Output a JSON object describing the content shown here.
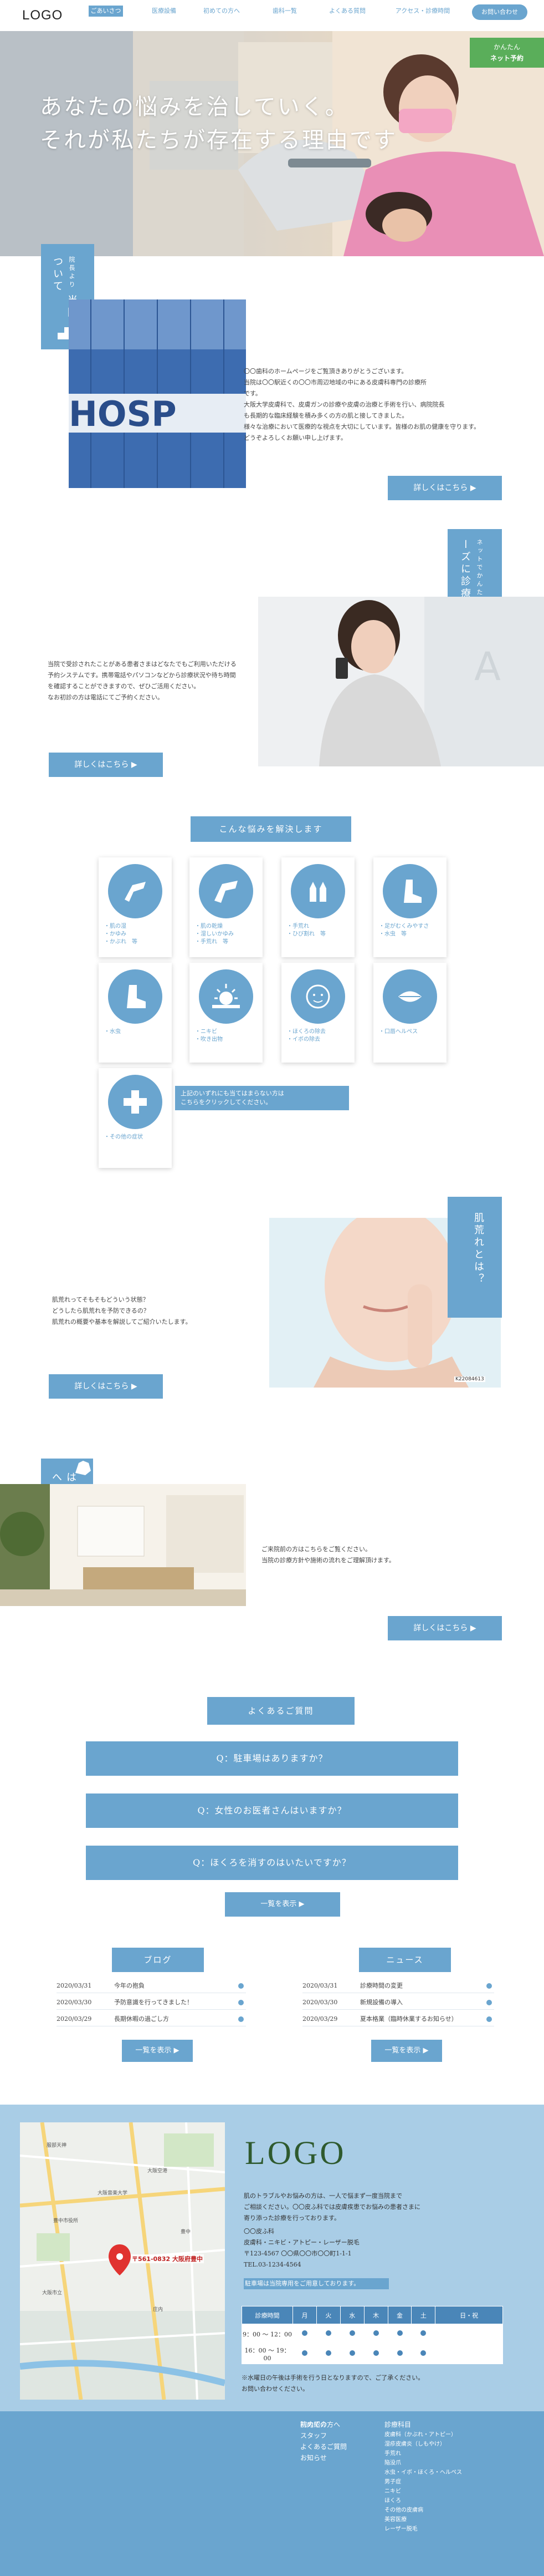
{
  "header": {
    "logo": "LOGO",
    "nav": [
      "ごあいさつ",
      "医療設備",
      "初めての方へ",
      "歯科一覧",
      "よくある質問",
      "アクセス・診療時間"
    ],
    "contact_button": "お問い合わせ",
    "side_button_line1": "かんたん",
    "side_button_line2": "ネット予約"
  },
  "hero": {
    "line1": "あなたの悩みを治していく。",
    "line2": "それが私たちが存在する理由です"
  },
  "greeting": {
    "label_small": "院長より",
    "label": "当院について",
    "text": [
      "〇〇歯科のホームページをご覧頂きありがとうございます。",
      "当院は〇〇駅近くの〇〇市周辺地域の中にある皮膚科専門の診療所",
      "です。",
      "大阪大学皮膚科で、皮膚ガンの診療や皮膚の治療と手術を行い、病院院長",
      "も長期的な臨床経験を積み多くの方の肌と接してきました。",
      "様々な治療において医療的な視点を大切にしています。皆様のお肌の健康を守ります。",
      "どうぞよろしくお願い申し上げます。"
    ],
    "more": "詳しくはこちら ▶"
  },
  "reserve": {
    "label_small": "ネットでかんたん",
    "label": "スムーズに診療",
    "text": [
      "当院で受診されたことがある患者さまはどなたでもご利用いただける",
      "予約システムです。携帯電話やパソコンなどから診療状況や待ち時間",
      "を確認することができますので、ぜひご活用ください。",
      "なお初診の方は電話にてご予約ください。"
    ],
    "more": "詳しくはこちら ▶"
  },
  "worries": {
    "title": "こんな悩みを解決します",
    "cards": [
      {
        "icon": "arm-icon",
        "lines": [
          "・肌の湿",
          "・かゆみ",
          "・かぶれ　等"
        ]
      },
      {
        "icon": "arm2-icon",
        "lines": [
          "・肌の乾燥",
          "・湿しいかゆみ",
          "・手荒れ　等"
        ]
      },
      {
        "icon": "hands-icon",
        "lines": [
          "・手荒れ",
          "・ひび割れ　等"
        ]
      },
      {
        "icon": "foot-icon",
        "lines": [
          "・足がむくみやすさ",
          "・水虫　等"
        ]
      },
      {
        "icon": "leg-icon",
        "lines": [
          "・水虫"
        ]
      },
      {
        "icon": "sun-icon",
        "lines": [
          "・ニキビ",
          "・吹き出物"
        ]
      },
      {
        "icon": "face-icon",
        "lines": [
          "・ほくろの除去",
          "・イボの除去"
        ]
      },
      {
        "icon": "lips-icon",
        "lines": [
          "・口唇ヘルペス"
        ]
      },
      {
        "icon": "cross-icon",
        "lines": [
          "・その他の症状"
        ]
      }
    ],
    "note_line1": "上記のいずれにも当てはまらない方は",
    "note_line2": "こちらをクリックしてください。"
  },
  "beauty": {
    "label": "肌荒れとは？",
    "text": [
      "肌荒れってそもそもどういう状態？",
      "どうしたら肌荒れを予防できるの？",
      "肌荒れの概要や基本を解説してご紹介いたします。"
    ],
    "more": "詳しくはこちら ▶",
    "photo_id": "K22084613"
  },
  "first": {
    "label": "はじめての方へ",
    "text": [
      "ご来院前の方はこちらをご覧ください。",
      "当院の診療方針や施術の流れをご理解頂けます。"
    ],
    "more": "詳しくはこちら ▶"
  },
  "faq": {
    "title": "よくあるご質問",
    "items": [
      "Q：駐車場はありますか？",
      "Q：女性のお医者さんはいますか？",
      "Q：ほくろを消すのはいたいですか？"
    ],
    "more": "一覧を表示 ▶"
  },
  "blog": {
    "title": "ブログ",
    "rows": [
      {
        "date": "2020/03/31",
        "title": "今年の抱負"
      },
      {
        "date": "2020/03/30",
        "title": "予防意識を行ってきました！"
      },
      {
        "date": "2020/03/29",
        "title": "長期休暇の過ごし方"
      }
    ],
    "more": "一覧を表示 ▶"
  },
  "news": {
    "title": "ニュース",
    "rows": [
      {
        "date": "2020/03/31",
        "title": "診療時間の変更"
      },
      {
        "date": "2020/03/30",
        "title": "新規設備の導入"
      },
      {
        "date": "2020/03/29",
        "title": "夏本格業（臨時休業するお知らせ）"
      }
    ],
    "more": "一覧を表示 ▶"
  },
  "access": {
    "logo": "LOGO",
    "intro": [
      "肌のトラブルやお悩みの方は、一人で悩まず一度当院まで",
      "ご相談ください。〇〇皮ふ科では皮膚疾患でお悩みの患者さまに",
      "寄り添った診療を行っております。"
    ],
    "clinic": "〇〇皮ふ科",
    "departments": "皮膚科・ニキビ・アトピー・レーザー脱毛",
    "postal": "〒123-4567 〇〇県〇〇市〇〇町1-1-1",
    "tel": "TEL.03-1234-4564",
    "highlight": "駐車場は当院専用をご用意しております。",
    "map_label": "〒561-0832 大阪府豊中",
    "map_places": [
      "服部天神",
      "大阪音楽大学",
      "豊中市役所",
      "大阪市立",
      "大阪空港",
      "豊中",
      "庄内"
    ],
    "schedule": {
      "header": [
        "診療時間",
        "月",
        "火",
        "水",
        "木",
        "金",
        "土",
        "日・祝"
      ],
      "rows": [
        {
          "time": "9：00 ～ 12：00",
          "days": [
            true,
            true,
            true,
            true,
            true,
            true,
            false
          ]
        },
        {
          "time": "16：00 ～ 19：00",
          "days": [
            true,
            true,
            true,
            true,
            true,
            true,
            false
          ]
        }
      ],
      "note_line1": "※水曜日の午後は手術を行う日となりますので、ご了承ください。",
      "note_line2": "お問い合わせください。"
    }
  },
  "footer": {
    "col1": [
      "初めての方へ",
      "院内紹介",
      "スタッフ",
      "よくあるご質問",
      "お知らせ"
    ],
    "col2_title": "診療科目",
    "col2": [
      "皮膚科（かぶれ・アトピー）",
      "湿疹皮膚炎（しもやけ）",
      "手荒れ",
      "陥没爪",
      "水虫・イボ・ほくろ・ヘルペス",
      "男子症",
      "ニキビ",
      "ほくろ",
      "その他の皮膚病",
      "美容医療",
      "レーザー脱毛"
    ]
  },
  "colors": {
    "accent": "#6aa5cf",
    "green": "#5aae5a",
    "access_bg": "#a9cde6"
  }
}
